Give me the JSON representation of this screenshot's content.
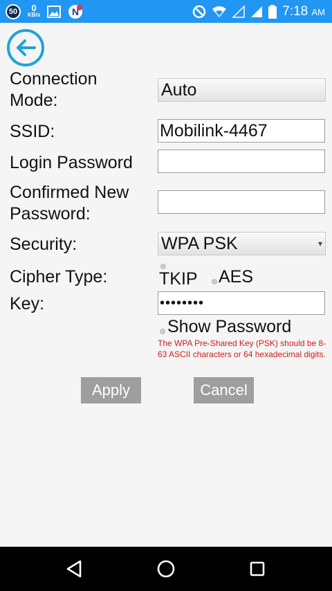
{
  "status_bar": {
    "badge": "50",
    "speed_value": "0",
    "speed_unit": "KB/s",
    "time": "7:18",
    "ampm": "AM",
    "icons": [
      "image-icon",
      "notification-n-icon",
      "do-not-disturb-icon",
      "wifi-icon",
      "signal-icon",
      "signal-icon",
      "battery-icon"
    ]
  },
  "form": {
    "connection_mode_label": "Connection Mode:",
    "connection_mode_value": "Auto",
    "ssid_label": "SSID:",
    "ssid_value": "Mobilink-4467",
    "login_password_label": "Login Password",
    "login_password_value": "",
    "confirm_password_label": "Confirmed New Password:",
    "confirm_password_value": "",
    "security_label": "Security:",
    "security_value": "WPA PSK",
    "cipher_label": "Cipher Type:",
    "cipher_options": [
      "TKIP",
      "AES"
    ],
    "key_label": "Key:",
    "key_value": "••••••••",
    "show_password_label": "Show Password",
    "hint": "The WPA Pre-Shared Key (PSK) should be 8-63 ASCII characters or 64 hexadecimal digits."
  },
  "buttons": {
    "apply": "Apply",
    "cancel": "Cancel"
  },
  "colors": {
    "status_bar": "#2196f3",
    "back_icon": "#1fa3d7",
    "hint_text": "#d01a1a",
    "button_bg": "#9e9e9e"
  }
}
